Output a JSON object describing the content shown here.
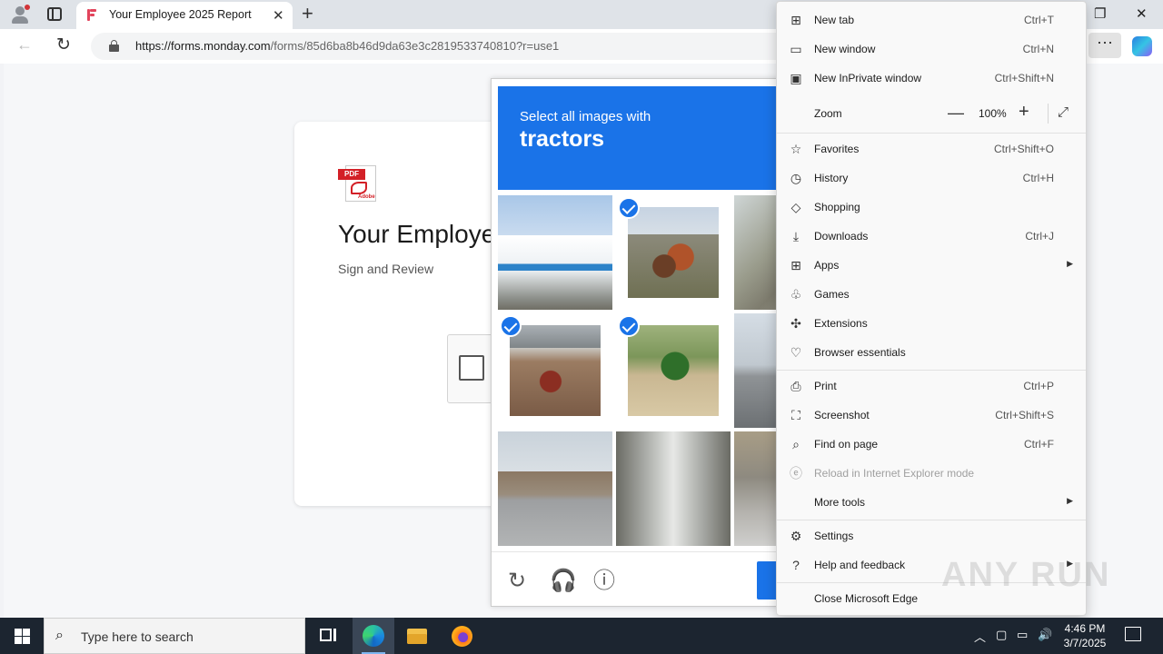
{
  "browser": {
    "tab_title": "Your Employee 2025 Report",
    "url_host": "https://forms.monday.com",
    "url_path": "/forms/85d6ba8b46d9da63e3c2819533740810?r=use1"
  },
  "form": {
    "pdf_label": "PDF",
    "pdf_brand": "Adobe",
    "title": "Your Employe",
    "subtitle": "Sign and Review"
  },
  "captcha": {
    "prompt": "Select all images with",
    "target": "tractors",
    "tiles": [
      {
        "subject": "blue building with bicycle",
        "selected": false
      },
      {
        "subject": "orange tractor",
        "selected": true
      },
      {
        "subject": "road on hillside",
        "selected": false
      },
      {
        "subject": "red tractor under bridge",
        "selected": true
      },
      {
        "subject": "green tractor in field",
        "selected": true
      },
      {
        "subject": "street with traffic light",
        "selected": false
      },
      {
        "subject": "street with bus",
        "selected": false
      },
      {
        "subject": "street with tram",
        "selected": false
      },
      {
        "subject": "street corner",
        "selected": false
      }
    ]
  },
  "menu": {
    "items": [
      {
        "label": "New tab",
        "shortcut": "Ctrl+T",
        "icon": "new-tab-icon"
      },
      {
        "label": "New window",
        "shortcut": "Ctrl+N",
        "icon": "new-window-icon"
      },
      {
        "label": "New InPrivate window",
        "shortcut": "Ctrl+Shift+N",
        "icon": "inprivate-icon"
      },
      {
        "label": "Zoom",
        "shortcut": "",
        "icon": ""
      },
      {
        "label": "Favorites",
        "shortcut": "Ctrl+Shift+O",
        "icon": "star-icon"
      },
      {
        "label": "History",
        "shortcut": "Ctrl+H",
        "icon": "history-icon"
      },
      {
        "label": "Shopping",
        "shortcut": "",
        "icon": "tag-icon"
      },
      {
        "label": "Downloads",
        "shortcut": "Ctrl+J",
        "icon": "download-icon"
      },
      {
        "label": "Apps",
        "shortcut": "",
        "icon": "apps-icon"
      },
      {
        "label": "Games",
        "shortcut": "",
        "icon": "games-icon"
      },
      {
        "label": "Extensions",
        "shortcut": "",
        "icon": "puzzle-icon"
      },
      {
        "label": "Browser essentials",
        "shortcut": "",
        "icon": "heart-pulse-icon"
      },
      {
        "label": "Print",
        "shortcut": "Ctrl+P",
        "icon": "printer-icon"
      },
      {
        "label": "Screenshot",
        "shortcut": "Ctrl+Shift+S",
        "icon": "screenshot-icon"
      },
      {
        "label": "Find on page",
        "shortcut": "Ctrl+F",
        "icon": "find-icon"
      },
      {
        "label": "Reload in Internet Explorer mode",
        "shortcut": "",
        "icon": "ie-icon"
      },
      {
        "label": "More tools",
        "shortcut": "",
        "icon": ""
      },
      {
        "label": "Settings",
        "shortcut": "",
        "icon": "gear-icon"
      },
      {
        "label": "Help and feedback",
        "shortcut": "",
        "icon": "help-icon"
      },
      {
        "label": "Close Microsoft Edge",
        "shortcut": "",
        "icon": ""
      }
    ],
    "zoom_value": "100%"
  },
  "watermark": "ANY RUN",
  "taskbar": {
    "search_placeholder": "Type here to search",
    "time": "4:46 PM",
    "date": "3/7/2025"
  }
}
